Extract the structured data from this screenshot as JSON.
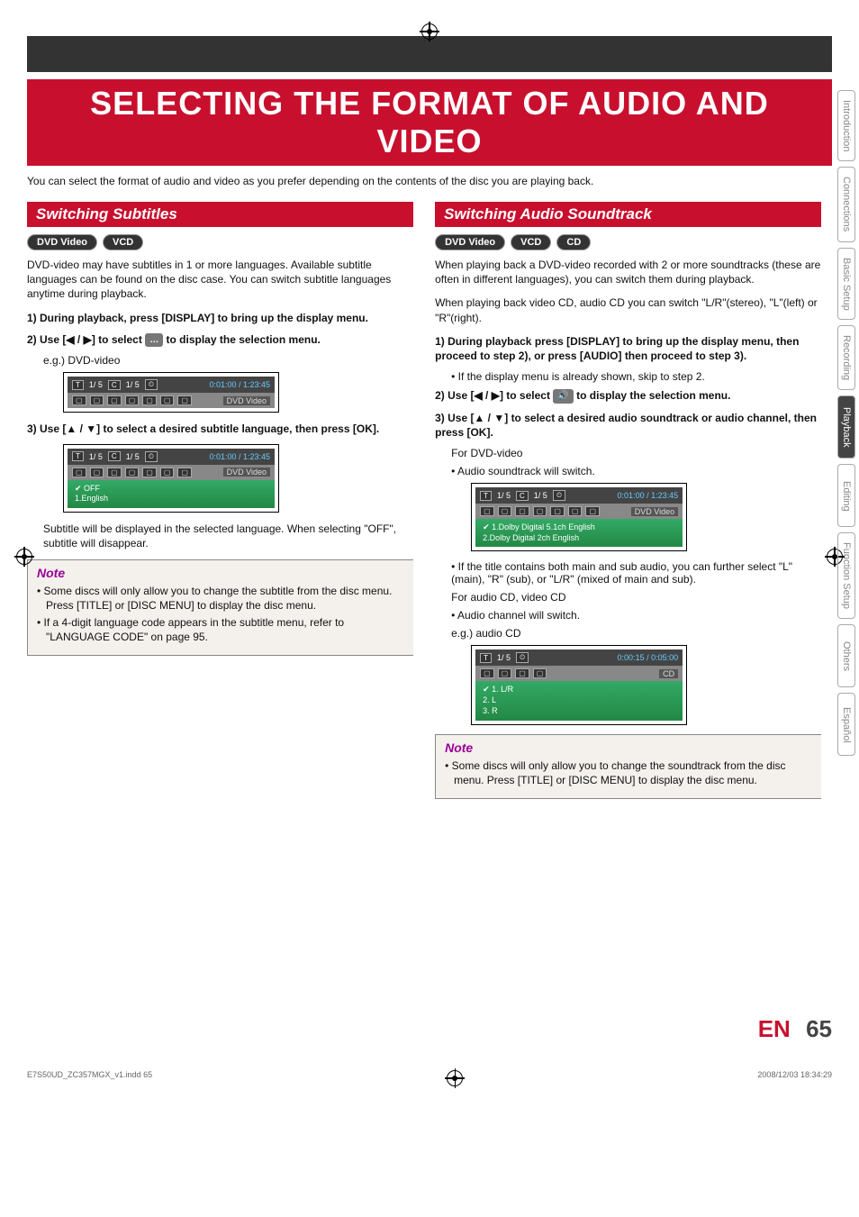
{
  "title": "SELECTING THE FORMAT OF AUDIO AND VIDEO",
  "intro": "You can select the format of audio and video as you prefer depending on the contents of the disc you are playing back.",
  "left": {
    "header": "Switching Subtitles",
    "badges": [
      "DVD Video",
      "VCD"
    ],
    "body": "DVD-video may have subtitles in 1 or more languages. Available subtitle languages can be found on the disc case. You can switch subtitle languages anytime during playback.",
    "step1": "During playback, press [DISPLAY] to bring up the display menu.",
    "step2_pre": "Use [",
    "step2_mid": "] to select ",
    "step2_post": " to display the selection menu.",
    "arrows2": "◀ / ▶",
    "icon2": "…",
    "eg1": "e.g.) DVD-video",
    "osd1_t": "T",
    "osd1_a": "1/  5",
    "osd1_c": "C",
    "osd1_b": "1/  5",
    "osd1_clock": "⏲",
    "osd1_time": "0:01:00 / 1:23:45",
    "osd1_label": "DVD  Video",
    "step3_pre": "Use [",
    "arrows3": "▲ / ▼",
    "step3_post": "] to select a desired subtitle language, then press [OK].",
    "osd2_opt1": "OFF",
    "osd2_opt2": "1.English",
    "result": "Subtitle will be displayed in the selected language. When selecting \"OFF\", subtitle will disappear.",
    "note_title": "Note",
    "notes": [
      "Some discs will only allow you to change the subtitle from the disc menu. Press [TITLE] or [DISC MENU] to display the disc menu.",
      "If a 4-digit language code appears in the subtitle menu, refer to \"LANGUAGE CODE\" on page 95."
    ]
  },
  "right": {
    "header": "Switching Audio Soundtrack",
    "badges": [
      "DVD Video",
      "VCD",
      "CD"
    ],
    "body1": "When playing back a DVD-video recorded with 2 or more soundtracks (these are often in different languages), you can switch them during playback.",
    "body2": "When playing back video CD, audio CD you can switch \"L/R\"(stereo), \"L\"(left) or \"R\"(right).",
    "step1": "During playback press [DISPLAY] to bring up the display menu, then proceed to step 2), or press [AUDIO] then proceed to step 3).",
    "step1_bullet": "If the display menu is already shown, skip to step 2.",
    "step2_pre": "Use [",
    "arrows2": "◀ / ▶",
    "step2_mid": "] to select ",
    "step2_icon": "🔊",
    "step2_post": " to display the selection menu.",
    "step3_pre": "Use [",
    "arrows3": "▲ / ▼",
    "step3_post": "] to select a desired audio soundtrack or audio channel, then press [OK].",
    "for_dvd": "For DVD-video",
    "dvd_switch": "Audio soundtrack will switch.",
    "osd3_tr1": "1.Dolby Digital   5.1ch English",
    "osd3_tr2": "2.Dolby Digital   2ch English",
    "mix_note": "If the title contains both main and sub audio, you can further select \"L\" (main), \"R\" (sub), or \"L/R\" (mixed of main and sub).",
    "for_cd": "For audio CD, video CD",
    "cd_switch": "Audio channel will switch.",
    "eg_cd": "e.g.) audio CD",
    "osd4_a": "1/  5",
    "osd4_time": "0:00:15 / 0:05:00",
    "osd4_label": "CD",
    "osd4_o1": "1. L/R",
    "osd4_o2": "2. L",
    "osd4_o3": "3. R",
    "note_title": "Note",
    "notes": [
      "Some discs will only allow you to change the soundtrack from the disc menu. Press [TITLE] or [DISC MENU] to display the disc menu."
    ]
  },
  "tabs": [
    "Introduction",
    "Connections",
    "Basic Setup",
    "Recording",
    "Playback",
    "Editing",
    "Function Setup",
    "Others",
    "Español"
  ],
  "active_tab": "Playback",
  "footer_en": "EN",
  "footer_page": "65",
  "print_left": "E7S50UD_ZC357MGX_v1.indd   65",
  "print_right": "2008/12/03   18:34:29"
}
